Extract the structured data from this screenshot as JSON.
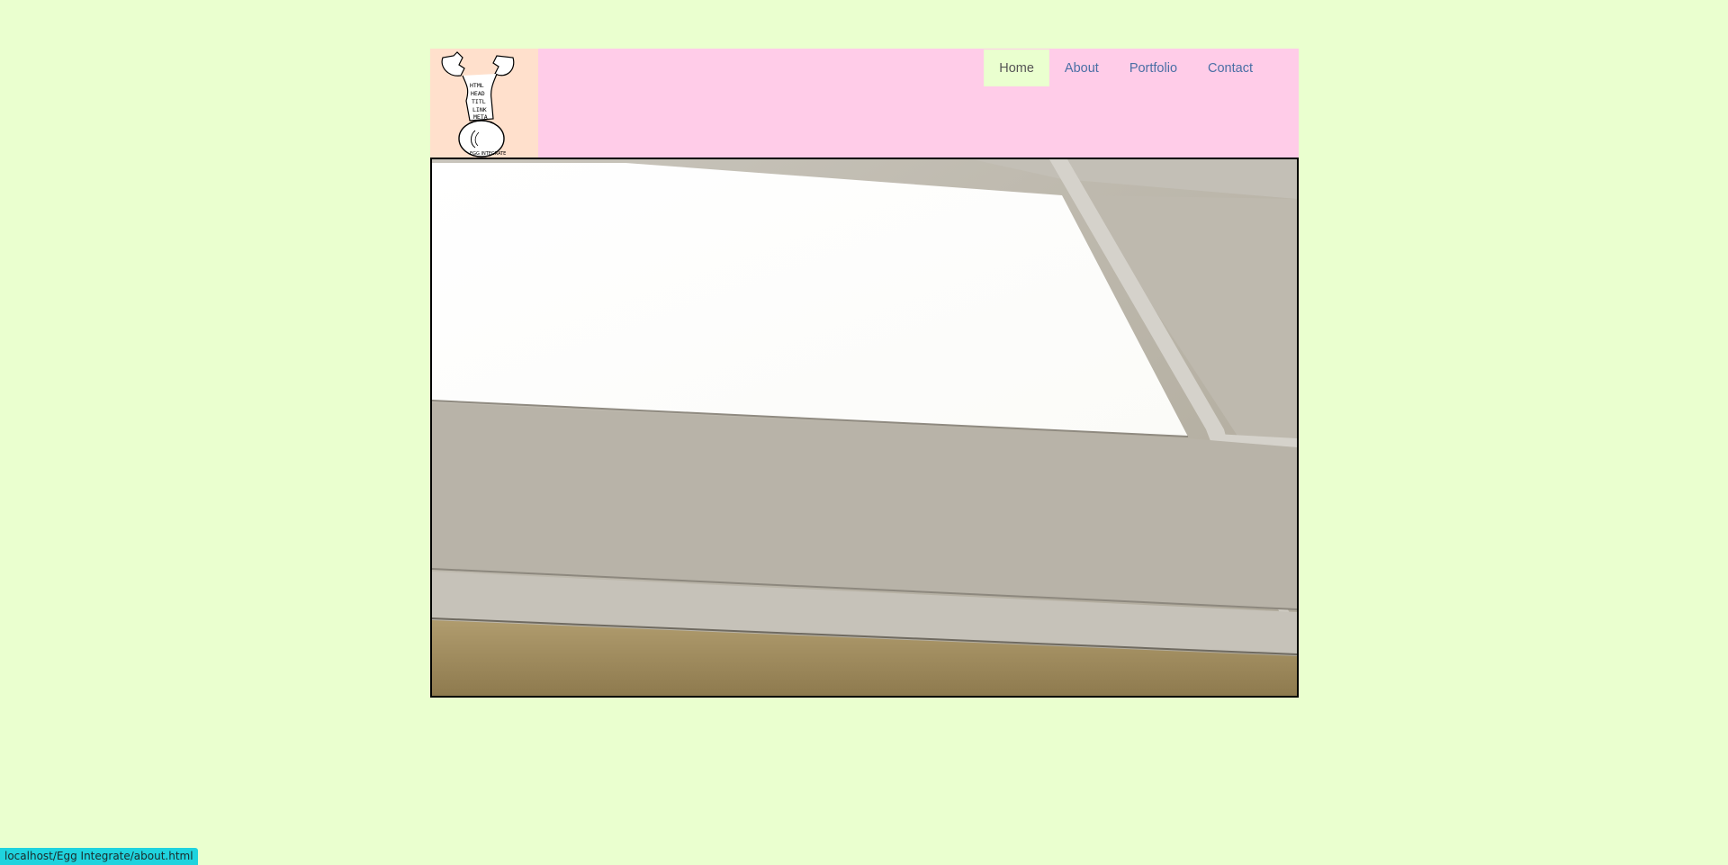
{
  "nav": {
    "items": [
      {
        "label": "Home",
        "active": true
      },
      {
        "label": "About",
        "active": false
      },
      {
        "label": "Portfolio",
        "active": false
      },
      {
        "label": "Contact",
        "active": false
      }
    ]
  },
  "logo": {
    "icon": "egg-head-logo-icon",
    "lines": [
      "HTML",
      "HEAD",
      "TITL",
      "LINK",
      "META"
    ],
    "caption": "EGG INTEGRATE"
  },
  "hero": {
    "icon": "ceiling-light-photo"
  },
  "status": {
    "url": "localhost/Egg Integrate/about.html"
  },
  "colors": {
    "page_background": "#eaffcf",
    "header_background": "#ffcce8",
    "logo_background": "#ffe0cc",
    "link": "#4a6fa5",
    "status_bar": "#1fd3de"
  }
}
